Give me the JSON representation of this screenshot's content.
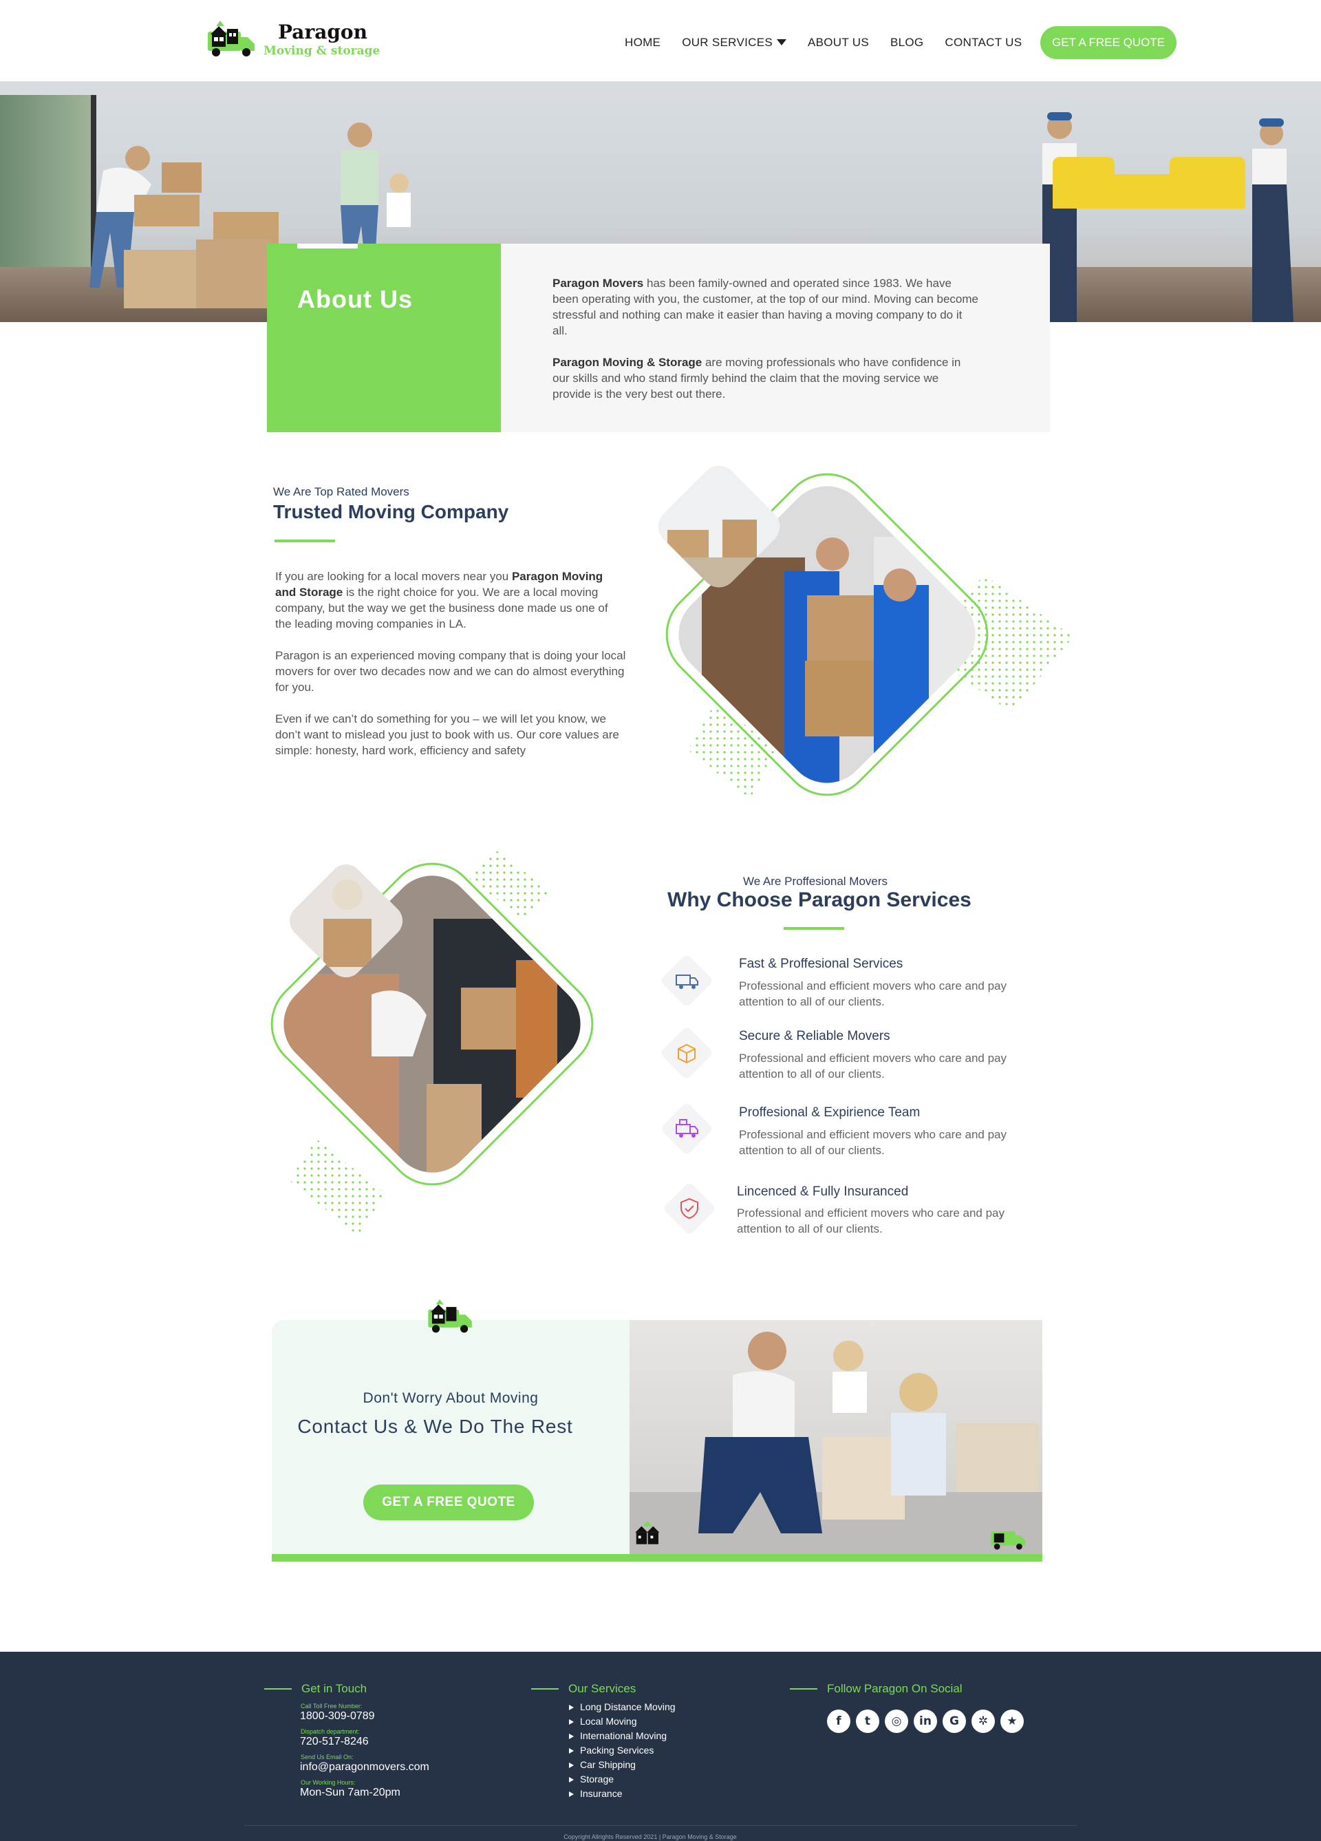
{
  "header": {
    "brand": "Paragon",
    "tagline": "Moving & storage",
    "nav": [
      "HOME",
      "OUR  SERVICES",
      "ABOUT US",
      "BLOG",
      "CONTACT US"
    ],
    "cta": "GET A FREE QUOTE"
  },
  "about": {
    "title": "About Us",
    "p1_bold": "Paragon Movers",
    "p1_text": " has been family-owned and operated since 1983. We have been operating with you, the customer, at the top of our mind. Moving can become stressful and nothing can make it easier than having a moving company to do it all.",
    "p2_bold": "Paragon Moving & Storage",
    "p2_text": " are moving professionals who have confidence in our skills and who stand firmly behind the claim that the moving service we provide is the very best out there."
  },
  "trusted": {
    "kicker": "We Are Top Rated Movers",
    "title": "Trusted Moving Company",
    "p1_a": "If you are looking for a local movers near you ",
    "p1_bold": "Paragon Moving and Storage",
    "p1_b": " is the right choice for you. We are a local moving company, but the way we get the business done made us one of the leading moving companies in LA.",
    "p2": "Paragon  is an experienced moving company that is doing your local movers for over two decades now and we can do almost everything for you.",
    "p3": "Even if we can’t do something for you – we will let you know, we don’t want to mislead you just to book with us. Our core values are simple: honesty, hard work, efficiency and safety"
  },
  "why": {
    "kicker": "We Are Proffesional Movers",
    "title": "Why Choose Paragon Services",
    "features": [
      {
        "title": "Fast & Proffesional Services",
        "desc": "Professional and efficient movers who care and pay attention to all of our clients.",
        "icon": "truck-icon",
        "color": "#4a6fa5"
      },
      {
        "title": "Secure & Reliable Movers",
        "desc": "Professional and efficient movers who care and pay attention to all of our clients.",
        "icon": "box-icon",
        "color": "#f0a030"
      },
      {
        "title": "Proffesional & Expirience Team",
        "desc": "Professional and efficient movers who care and pay attention to all of our clients.",
        "icon": "moving-truck-icon",
        "color": "#b04de0"
      },
      {
        "title": "Lincenced & Fully Insuranced",
        "desc": "Professional and efficient movers who care and pay attention to all of our clients.",
        "icon": "shield-check-icon",
        "color": "#e05555"
      }
    ]
  },
  "cta": {
    "kicker": "Don't Worry About Moving",
    "title": "Contact Us & We Do The Rest",
    "button": "GET A FREE QUOTE"
  },
  "footer": {
    "touch_heading": "Get in Touch",
    "toll_label": "Call Toll Free Number:",
    "toll_value": "1800-309-0789",
    "dispatch_label": "Dispatch department:",
    "dispatch_value": "720-517-8246",
    "email_label": "Send Us Email On:",
    "email_value": "info@paragonmovers.com",
    "hours_label": "Our Working Hours:",
    "hours_value": "Mon-Sun 7am-20pm",
    "services_heading": "Our Services",
    "services": [
      "Long Distance Moving",
      "Local Moving",
      "International Moving",
      "Packing Services",
      "Car Shipping",
      "Storage",
      "Insurance"
    ],
    "social_heading": "Follow Paragon On Social",
    "social": [
      "facebook-icon",
      "twitter-icon",
      "instagram-icon",
      "linkedin-icon",
      "google-icon",
      "yelp-icon",
      "star-icon"
    ],
    "copyright": "Copyright Allrights Reserved 2021  |  Paragon Moving & Storage"
  },
  "colors": {
    "accent": "#7ed957",
    "navy": "#2c3e5c",
    "footer_bg": "#263347"
  }
}
